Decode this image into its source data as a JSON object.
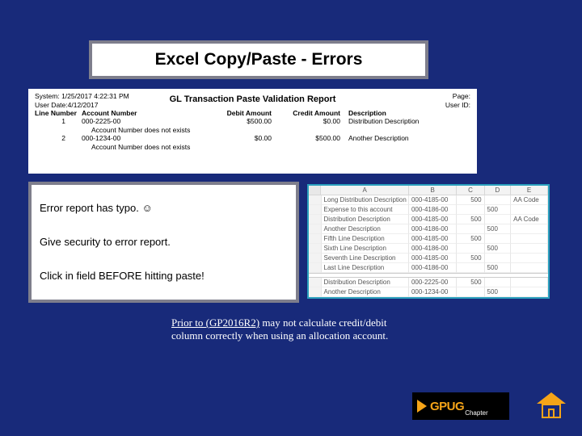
{
  "title": "Excel Copy/Paste - Errors",
  "report": {
    "system_label": "System:",
    "system_value": "1/25/2017   4:22:31 PM",
    "userdate_label": "User Date:",
    "userdate_value": "4/12/2017",
    "page_label": "Page:",
    "userid_label": "User ID:",
    "title": "GL Transaction Paste Validation Report",
    "columns": {
      "line": "Line Number",
      "account": "Account Number",
      "debit": "Debit Amount",
      "credit": "Credit Amount",
      "desc": "Description"
    },
    "rows": [
      {
        "line": "1",
        "account": "000-2225-00",
        "debit": "$500.00",
        "credit": "$0.00",
        "desc": "Distribution Description",
        "error": "Account Number does not exists"
      },
      {
        "line": "2",
        "account": "000-1234-00",
        "debit": "$0.00",
        "credit": "$500.00",
        "desc": "Another Description",
        "error": "Account Number does not exists"
      }
    ]
  },
  "tips": {
    "line1a": "Error report has typo. ",
    "line1b": "☺",
    "line2": "Give security to error report.",
    "line3": "Click in field BEFORE hitting paste!"
  },
  "excel": {
    "headers": [
      "A",
      "B",
      "C",
      "D",
      "E"
    ],
    "rows": [
      [
        "Long Distribution Description",
        "000-4185-00",
        "500",
        "",
        "AA Code"
      ],
      [
        "Expense to this account",
        "000-4186-00",
        "",
        "500",
        ""
      ],
      [
        "Distribution Description",
        "000-4185-00",
        "500",
        "",
        "AA Code"
      ],
      [
        "Another Description",
        "000-4186-00",
        "",
        "500",
        ""
      ],
      [
        "Fifth Line Description",
        "000-4185-00",
        "500",
        "",
        ""
      ],
      [
        "Sixth Line Description",
        "000-4186-00",
        "",
        "500",
        ""
      ],
      [
        "Seventh Line Description",
        "000-4185-00",
        "500",
        "",
        ""
      ],
      [
        "Last Line Description",
        "000-4186-00",
        "",
        "500",
        ""
      ]
    ],
    "rows2": [
      [
        "Distribution Description",
        "000-2225-00",
        "500",
        "",
        ""
      ],
      [
        "Another Description",
        "000-1234-00",
        "",
        "500",
        ""
      ]
    ]
  },
  "note": {
    "underlined": "Prior to (GP2016R2)",
    "rest": " may not calculate credit/debit column correctly when using an allocation account."
  },
  "logo": {
    "brand": "GPUG",
    "sub": "Chapter"
  }
}
